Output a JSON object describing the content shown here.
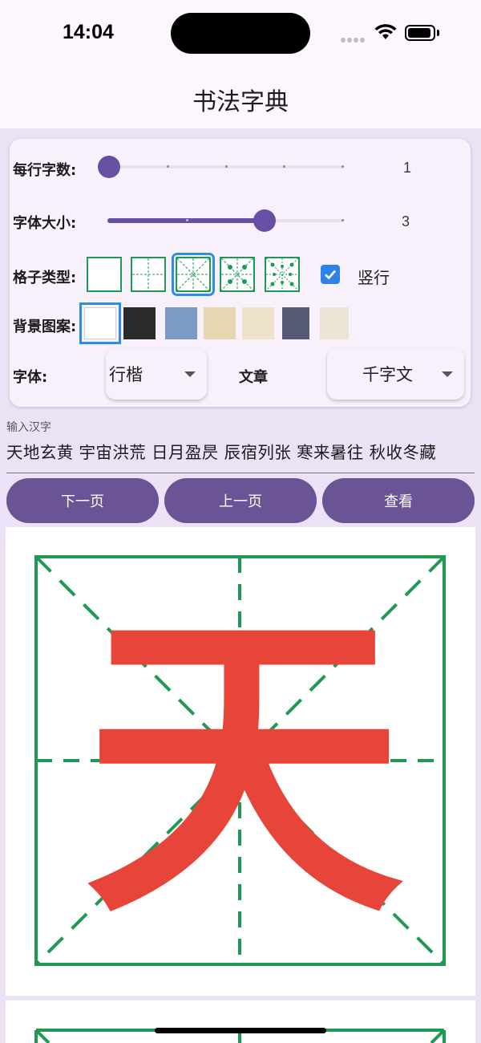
{
  "status": {
    "time": "14:04"
  },
  "app": {
    "title": "书法字典"
  },
  "settings": {
    "chars_per_row": {
      "label": "每行字数:",
      "value": "1",
      "level_fraction": 0.0
    },
    "font_size": {
      "label": "字体大小:",
      "value": "3",
      "level_fraction": 0.67
    },
    "grid_type": {
      "label": "格子类型:",
      "options": [
        "blank-grid",
        "tian-grid",
        "mi-grid",
        "hui-grid",
        "dot-mi-grid"
      ],
      "selected_index": 2
    },
    "vertical": {
      "label": "竖行",
      "checked": true
    },
    "background": {
      "label": "背景图案:",
      "selected_index": 0,
      "colors": [
        "#ffffff",
        "#2a2a2c",
        "#7b9bc6",
        "#e6d7b0",
        "#ede3c8",
        "#575a74",
        "#ece5d3"
      ]
    },
    "font": {
      "label": "字体:",
      "value": "行楷"
    },
    "article": {
      "label": "文章",
      "value": "千字文"
    }
  },
  "input": {
    "label": "输入汉字",
    "value": "天地玄黄 宇宙洪荒 日月盈昃 辰宿列张 寒来暑往 秋收冬藏"
  },
  "buttons": {
    "next": "下一页",
    "prev": "上一页",
    "view": "查看"
  },
  "preview": {
    "character": "天",
    "char_color": "#e8453a",
    "grid_color": "#1e9a55"
  },
  "colors": {
    "accent": "#6750a4",
    "button": "#6a5495",
    "selected_outline": "#2e8ee6"
  }
}
